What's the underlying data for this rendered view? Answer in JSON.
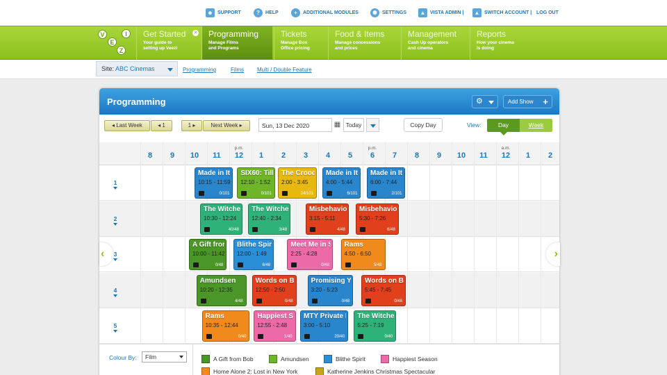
{
  "top_links": [
    {
      "label": "SUPPORT",
      "icon": "person-icon"
    },
    {
      "label": "HELP",
      "icon": "help-icon"
    },
    {
      "label": "ADDITIONAL MODULES",
      "icon": "plus-icon"
    },
    {
      "label": "SETTINGS",
      "icon": "gear-icon"
    },
    {
      "label": "VISTA ADMIN |",
      "icon": "admin-icon"
    },
    {
      "label": "SWITCH ACCOUNT |",
      "icon": "switch-account-icon"
    },
    {
      "label": "LOG OUT",
      "icon": ""
    }
  ],
  "logo_letters": [
    "V",
    "E",
    "Z",
    "I"
  ],
  "nav": [
    {
      "title": "Get Started",
      "sub1": "Your guide to",
      "sub2": "setting up Veezi",
      "closable": true
    },
    {
      "title": "Programming",
      "sub1": "Manage Films",
      "sub2": "and Programs",
      "active": true
    },
    {
      "title": "Tickets",
      "sub1": "Manage Box",
      "sub2": "Office pricing"
    },
    {
      "title": "Food & Items",
      "sub1": "Manage concessions",
      "sub2": "and prices"
    },
    {
      "title": "Management",
      "sub1": "Cash Up operators",
      "sub2": "and cinema"
    },
    {
      "title": "Reports",
      "sub1": "How your cinema",
      "sub2": "is doing"
    }
  ],
  "site": {
    "label": "Site:",
    "value": "ABC Cinemas"
  },
  "sublinks": [
    "Programming",
    "Films",
    "Multi / Double Feature"
  ],
  "panel": {
    "title": "Programming",
    "gear": "⚙",
    "add_show": "Add Show",
    "add_plus": "+"
  },
  "toolbar": {
    "last_week": "◂ Last Week",
    "prev": "◂ 1",
    "next": "1 ▸",
    "next_week": "Next Week ▸",
    "date": "Sun, 13 Dec 2020",
    "calendar": "▦",
    "today": "Today",
    "copy_day": "Copy Day",
    "view_label": "View:",
    "view_day": "Day",
    "view_week": "Week"
  },
  "hours": [
    "8",
    "9",
    "10",
    "11",
    "12",
    "1",
    "2",
    "3",
    "4",
    "5",
    "6",
    "7",
    "8",
    "9",
    "10",
    "11",
    "12",
    "1",
    "2"
  ],
  "ampm": [
    {
      "after": "11",
      "label": "p.m."
    },
    {
      "after": "5",
      "label": "p.m."
    },
    {
      "after": "11",
      "label": "a.m."
    }
  ],
  "screens": [
    "1",
    "2",
    "3",
    "4",
    "5"
  ],
  "shows": [
    {
      "screen": 1,
      "film": "Made in Italy",
      "name": "Made in It:",
      "time": "10:15 - 11:59",
      "occ": "0/101",
      "color": "#2a86cc"
    },
    {
      "screen": 1,
      "film": "SIX60: Till The Lights Go Out",
      "name": "SIX60: Till",
      "time": "12:10 - 1:52",
      "occ": "0/101",
      "color": "#6fb52a"
    },
    {
      "screen": 1,
      "film": "The Croods",
      "name": "The Crood",
      "time": "2:00 - 3:45",
      "occ": "24/101",
      "color": "#e6b810"
    },
    {
      "screen": 1,
      "film": "Made in Italy",
      "name": "Made in It:",
      "time": "4:00 - 5:44",
      "occ": "6/101",
      "color": "#2a86cc"
    },
    {
      "screen": 1,
      "film": "Made in Italy",
      "name": "Made in It:",
      "time": "6:00 - 7:44",
      "occ": "2/101",
      "color": "#2a86cc"
    },
    {
      "screen": 2,
      "film": "The Witches",
      "name": "The Witche",
      "time": "10:30 - 12:24",
      "occ": "40/48",
      "color": "#2fb27a"
    },
    {
      "screen": 2,
      "film": "The Witches",
      "name": "The Witche",
      "time": "12:40 - 2:34",
      "occ": "3/48",
      "color": "#2fb27a"
    },
    {
      "screen": 2,
      "film": "Misbehaviour",
      "name": "Misbehavio",
      "time": "3:15 - 5:11",
      "occ": "4/48",
      "color": "#e0401c"
    },
    {
      "screen": 2,
      "film": "Misbehaviour",
      "name": "Misbehavio",
      "time": "5:30 - 7:26",
      "occ": "6/48",
      "color": "#e0401c"
    },
    {
      "screen": 3,
      "film": "A Gift from Bob",
      "name": "A Gift fror",
      "time": "10:00 - 11:42",
      "occ": "0/48",
      "color": "#4a9626"
    },
    {
      "screen": 3,
      "film": "Blithe Spirit",
      "name": "Blithe Spir",
      "time": "12:00 - 1:49",
      "occ": "6/48",
      "color": "#2a8fd6"
    },
    {
      "screen": 3,
      "film": "Meet Me in St. Louis",
      "name": "Meet Me in S",
      "time": "2:25 - 4:28",
      "occ": "0/48",
      "color": "#ec6aa8"
    },
    {
      "screen": 3,
      "film": "Rams",
      "name": "Rams",
      "time": "4:50 - 6:50",
      "occ": "5/48",
      "color": "#f08a1c"
    },
    {
      "screen": 4,
      "film": "Amundsen",
      "name": "Amundsen",
      "time": "10:20 - 12:35",
      "occ": "4/48",
      "color": "#4a9626"
    },
    {
      "screen": 4,
      "film": "Words on Bathroom Walls",
      "name": "Words on B",
      "time": "12:50 - 2:50",
      "occ": "0/48",
      "color": "#e0401c"
    },
    {
      "screen": 4,
      "film": "Promising Young Woman",
      "name": "Promising Y",
      "time": "3:20 - 5:23",
      "occ": "0/48",
      "color": "#2a86cc"
    },
    {
      "screen": 4,
      "film": "Words on Bathroom Walls",
      "name": "Words on B",
      "time": "5:45 - 7:45",
      "occ": "0/48",
      "color": "#e0401c"
    },
    {
      "screen": 5,
      "film": "Rams",
      "name": "Rams",
      "time": "10:35 - 12:44",
      "occ": "0/40",
      "color": "#f08a1c"
    },
    {
      "screen": 5,
      "film": "Happiest Season",
      "name": "Happiest S",
      "time": "12:55 - 2:48",
      "occ": "1/40",
      "color": "#ec6aa8"
    },
    {
      "screen": 5,
      "film": "MTY Private Hire",
      "name": "MTY Private H",
      "time": "3:00 - 5:10",
      "occ": "20/40",
      "color": "#2a86cc"
    },
    {
      "screen": 5,
      "film": "The Witches",
      "name": "The Witche",
      "time": "5:25 - 7:19",
      "occ": "0/40",
      "color": "#2fb27a"
    }
  ],
  "legend": {
    "label": "Colour By:",
    "select": "Film",
    "items": [
      {
        "label": "A Gift from Bob",
        "color": "#4a9626"
      },
      {
        "label": "Amundsen",
        "color": "#6fb52a"
      },
      {
        "label": "Blithe Spirit",
        "color": "#2a8fd6"
      },
      {
        "label": "Happiest Season",
        "color": "#ec6aa8"
      },
      {
        "label": "Home Alone 2: Lost in New York",
        "color": "#f08a1c"
      },
      {
        "label": "Katherine Jenkins Christmas Spectacular",
        "color": "#c8a418"
      }
    ]
  }
}
